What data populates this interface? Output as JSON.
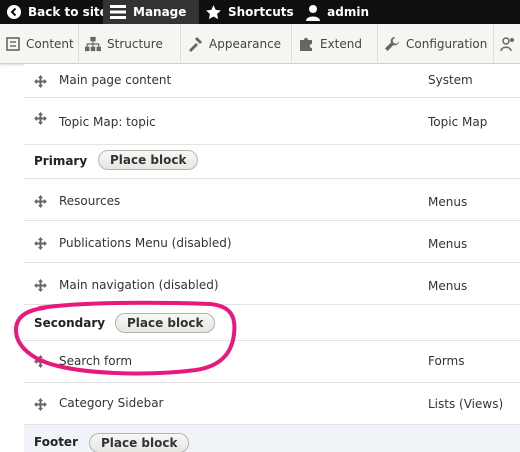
{
  "toolbar": {
    "back_label": "Back to site",
    "manage_label": "Manage",
    "shortcuts_label": "Shortcuts",
    "user_label": "admin"
  },
  "tray": {
    "content": "Content",
    "structure": "Structure",
    "appearance": "Appearance",
    "extend": "Extend",
    "configuration": "Configuration"
  },
  "blocks": {
    "main_page_content": {
      "title": "Main page content",
      "category": "System"
    },
    "topic_map": {
      "title": "Topic Map: topic",
      "category": "Topic Map"
    },
    "resources": {
      "title": "Resources",
      "category": "Menus"
    },
    "publications_menu": {
      "title": "Publications Menu (disabled)",
      "category": "Menus"
    },
    "main_navigation": {
      "title": "Main navigation (disabled)",
      "category": "Menus"
    },
    "search_form": {
      "title": "Search form",
      "category": "Forms"
    },
    "category_sidebar": {
      "title": "Category Sidebar",
      "category": "Lists (Views)"
    }
  },
  "regions": {
    "primary": {
      "name": "Primary",
      "button": "Place block"
    },
    "secondary": {
      "name": "Secondary",
      "button": "Place block"
    },
    "footer": {
      "name": "Footer",
      "button": "Place block"
    }
  },
  "colors": {
    "toolbar_bg": "#0f0f0f",
    "annotation": "#e8197a"
  },
  "icons": [
    "drupal-back-icon",
    "menu-icon",
    "star-icon",
    "user-icon",
    "content-icon",
    "structure-icon",
    "appearance-icon",
    "extend-icon",
    "wrench-icon",
    "people-icon",
    "drag-handle-icon"
  ]
}
